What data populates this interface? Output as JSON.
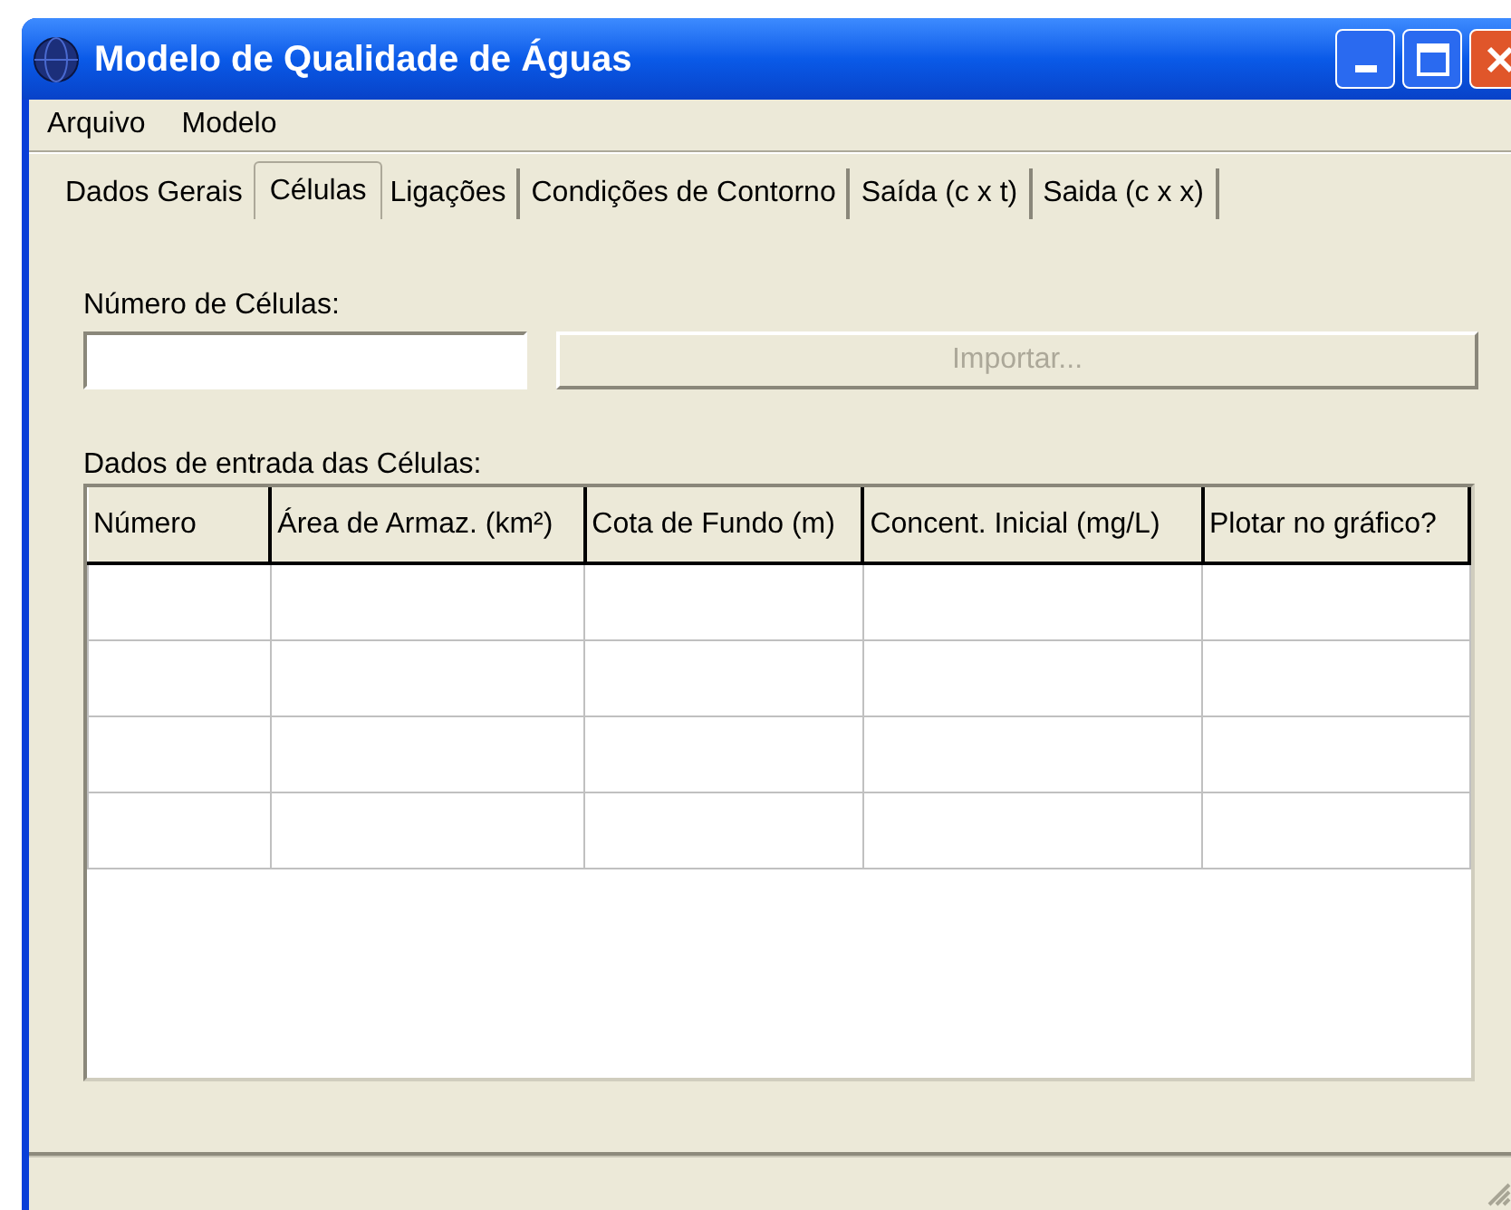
{
  "window": {
    "title": "Modelo de Qualidade de Águas"
  },
  "menu": [
    {
      "label": "Arquivo"
    },
    {
      "label": "Modelo"
    }
  ],
  "tabs": [
    {
      "label": "Dados Gerais",
      "selected": false
    },
    {
      "label": "Células",
      "selected": true
    },
    {
      "label": "Ligações",
      "selected": false
    },
    {
      "label": "Condições de Contorno",
      "selected": false
    },
    {
      "label": "Saída (c x t)",
      "selected": false
    },
    {
      "label": "Saida (c x x)",
      "selected": false
    }
  ],
  "cells_count": {
    "label": "Número de Células:"
  },
  "import_button": {
    "label": "Importar...",
    "disabled": true
  },
  "table": {
    "title": "Dados de entrada das Células:",
    "columns": [
      "Número",
      "Área de Armaz. (km²)",
      "Cota de Fundo (m)",
      "Concent. Inicial (mg/L)",
      "Plotar no gráfico?"
    ]
  }
}
